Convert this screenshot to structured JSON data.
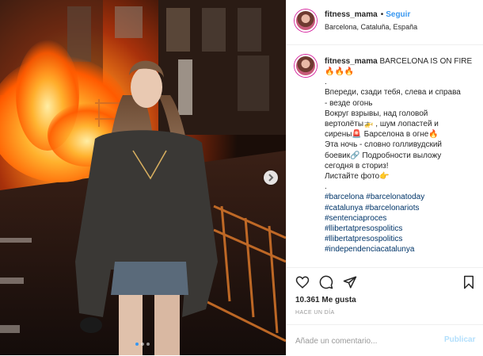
{
  "header": {
    "username": "fitness_mama",
    "separator": "•",
    "follow_label": "Seguir",
    "location": "Barcelona, Cataluña, España"
  },
  "caption": {
    "username": "fitness_mama",
    "headline": "BARCELONA IS ON FIRE",
    "lines": [
      "🔥🔥🔥",
      ".",
      "Впереди, сзади тебя, слева и справа",
      "- везде огонь",
      "Вокруг взрывы, над головой",
      "вертолёты🚁 , шум лопастей и",
      "сирены🚨 Барселона в огне🔥",
      "Эта ночь - словно голливудский",
      "боевик🔗 Подробности выложу",
      "сегодня в сториз!",
      "Листайте фото👉",
      "."
    ],
    "hashtags": [
      "#barcelona #barcelonatoday",
      "#catalunya #barcelonariots",
      "#sentenciaproces",
      "#llibertatpresospolitics",
      "#llibertatpresospolitics",
      "#independenciacatalunya"
    ]
  },
  "actions": {
    "icons": [
      "heart-icon",
      "comment-icon",
      "share-icon",
      "bookmark-icon"
    ],
    "likes": "10.361 Me gusta",
    "timestamp": "HACE UN DÍA"
  },
  "comment_box": {
    "placeholder": "Añade un comentario...",
    "publish_label": "Publicar"
  },
  "carousel": {
    "slide_count": 3,
    "active_slide": 1
  },
  "colors": {
    "link": "#3897f0",
    "hashtag": "#003569",
    "publish_disabled": "#b2dffc",
    "muted": "#999999",
    "text": "#262626",
    "fire": "#ff6a00"
  }
}
